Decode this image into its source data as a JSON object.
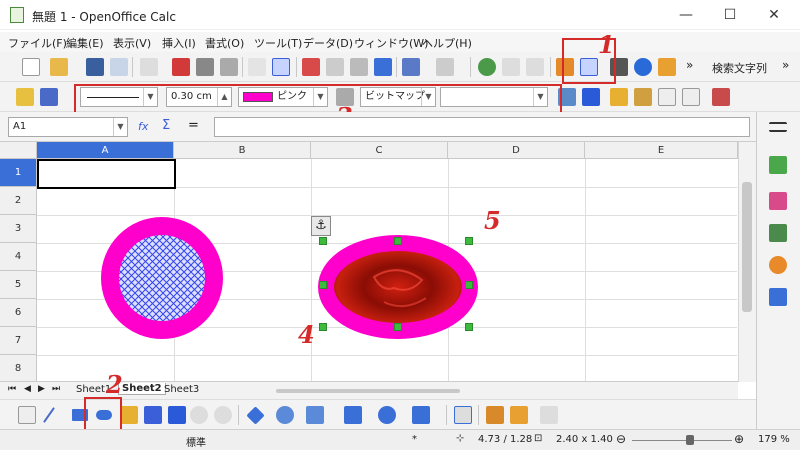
{
  "window": {
    "title": "無題 1 - OpenOffice Calc",
    "minimize": "—",
    "maximize": "☐",
    "close": "✕"
  },
  "menu": [
    "ファイル(F)",
    "編集(E)",
    "表示(V)",
    "挿入(I)",
    "書式(O)",
    "ツール(T)",
    "データ(D)",
    "ウィンドウ(W)",
    "ヘルプ(H)"
  ],
  "standard_toolbar": {
    "find_text": "検索文字列",
    "overflow": "»"
  },
  "drawing_object_bar": {
    "line_width": "0.30 cm",
    "area_color": "ピンク",
    "area_fill": "ビットマップ",
    "area_fill_option": ""
  },
  "formula_bar": {
    "name_box": "A1",
    "fx": "fx",
    "sum": "Σ",
    "equals": "=",
    "content": ""
  },
  "columns": [
    "A",
    "B",
    "C",
    "D",
    "E"
  ],
  "rows": [
    "1",
    "2",
    "3",
    "4",
    "5",
    "6",
    "7",
    "8"
  ],
  "sheets": [
    "Sheet1",
    "Sheet2",
    "Sheet3"
  ],
  "active_sheet": "Sheet2",
  "status": {
    "page_style": "標準",
    "mode": "*",
    "position": "4.73 / 1.28",
    "size": "2.40 x 1.40",
    "zoom": "179 %"
  },
  "annotations": {
    "a1": "1",
    "a2": "2",
    "a3": "3",
    "a4": "4",
    "a5": "5"
  },
  "colors": {
    "pink": "#ff00cc",
    "annotation_red": "#d42a2a",
    "selected_header": "#3a6fd8",
    "hatch_blue": "#3344ee"
  }
}
